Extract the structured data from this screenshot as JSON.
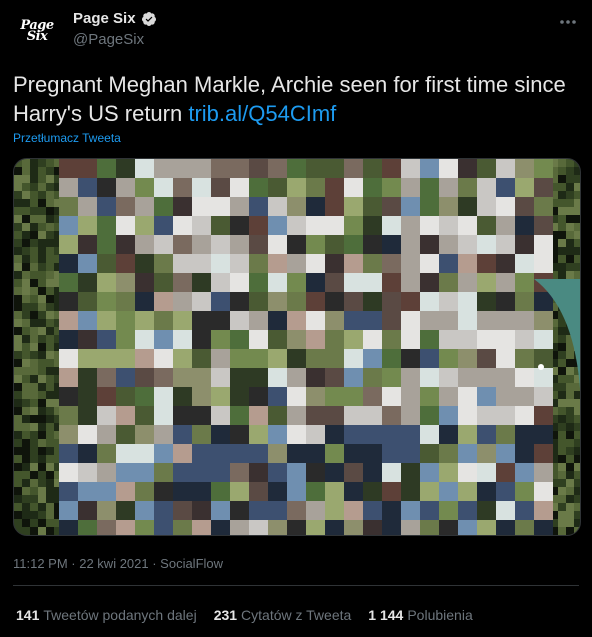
{
  "author": {
    "avatar_line1": "Page",
    "avatar_line2": "Six",
    "name": "Page Six",
    "handle": "@PageSix"
  },
  "tweet": {
    "text": "Pregnant Meghan Markle, Archie seen for first time since Harry's US return ",
    "link": "trib.al/Q54CImf",
    "translate": "Przetłumacz Tweeta"
  },
  "meta": {
    "time": "11:12 PM · 22 kwi 2021 · SocialFlow"
  },
  "stats": {
    "retweets_count": "141",
    "retweets_label": "Tweetów podanych dalej",
    "quotes_count": "231",
    "quotes_label": "Cytatów z Tweeta",
    "likes_count": "1 144",
    "likes_label": "Polubienia"
  },
  "colors": {
    "accent": "#1d9bf0",
    "muted": "#6e767d",
    "verified": "#d9d9d9"
  },
  "icons": [
    "verified-badge-icon",
    "more-options-icon"
  ]
}
